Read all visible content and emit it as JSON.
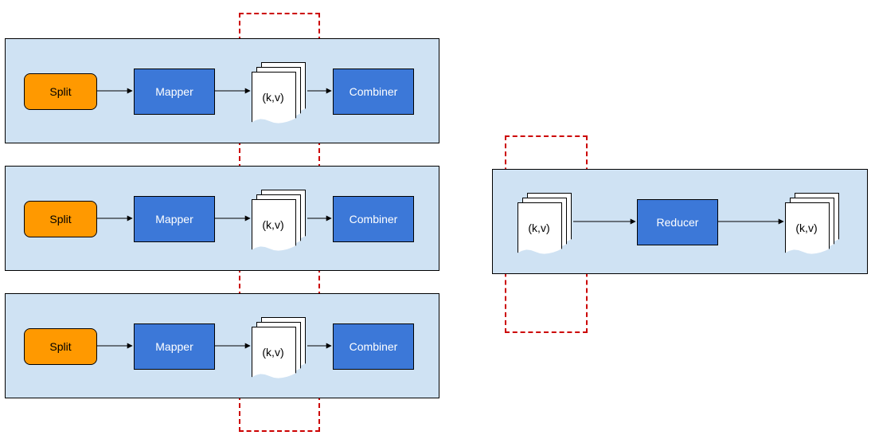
{
  "mapper_rows": [
    {
      "split": "Split",
      "mapper": "Mapper",
      "kv": "(k,v)",
      "combiner": "Combiner"
    },
    {
      "split": "Split",
      "mapper": "Mapper",
      "kv": "(k,v)",
      "combiner": "Combiner"
    },
    {
      "split": "Split",
      "mapper": "Mapper",
      "kv": "(k,v)",
      "combiner": "Combiner"
    }
  ],
  "reducer": {
    "input_kv": "(k,v)",
    "label": "Reducer",
    "output_kv": "(k,v)"
  },
  "colors": {
    "panel_bg": "#CFE2F3",
    "split_bg": "#FF9900",
    "stage_bg": "#3C78D8",
    "dashed_border": "#CC0000"
  }
}
